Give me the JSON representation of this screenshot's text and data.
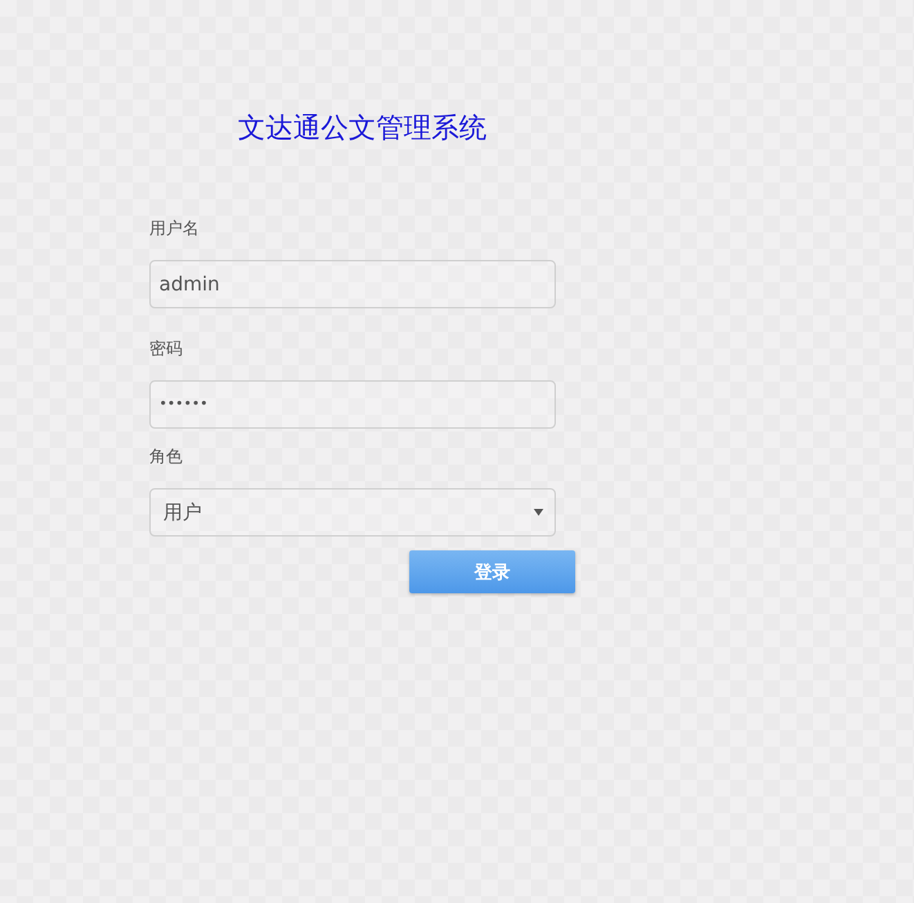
{
  "title": "文达通公文管理系统",
  "fields": [
    {
      "kind": "text",
      "label": "用户名",
      "value": "admin"
    },
    {
      "kind": "password",
      "label": "密码",
      "value": "••••••"
    },
    {
      "kind": "select",
      "label": "角色",
      "value": "用户"
    }
  ],
  "button": "登录"
}
